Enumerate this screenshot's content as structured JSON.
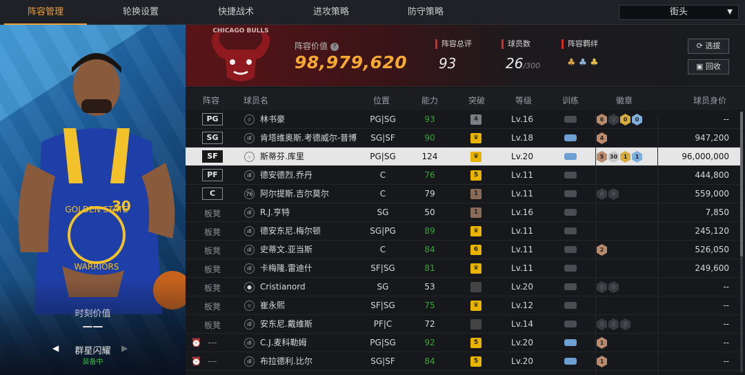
{
  "top_tabs": [
    "阵容管理",
    "轮换设置",
    "快捷战术",
    "进攻策略",
    "防守策略"
  ],
  "active_tab": "阵容管理",
  "mode_select": {
    "value": "街头"
  },
  "left_panel": {
    "moment_label": "时刻价值",
    "moment_value": "——",
    "skin_name": "群星闪耀",
    "skin_status": "装备中"
  },
  "header": {
    "lineup_value_label": "阵容价值",
    "lineup_value": "98,979,620",
    "overall_label": "阵容总评",
    "overall_value": "93",
    "roster_label": "球员数",
    "roster_count": "26",
    "roster_max": "/300",
    "chemistry_label": "阵容羁绊",
    "select_button": "选拔",
    "recycle_button": "回收",
    "logo_text": "CHICAGO BULLS"
  },
  "columns": [
    "阵容",
    "球员名",
    "位置",
    "能力",
    "突破",
    "等级",
    "训练",
    "徽章",
    "球员身价"
  ],
  "players": [
    {
      "slot": "PG",
      "name": "林书豪",
      "pos": "PG|SG",
      "ability": "93",
      "ability_green": true,
      "breakthrough": "4",
      "brk_style": "grey",
      "level": "Lv.16",
      "train": "grey",
      "badges": [
        [
          "b",
          "6"
        ],
        [
          "e",
          "0"
        ],
        [
          "g",
          "0"
        ],
        [
          "h",
          "0"
        ]
      ],
      "value": "--",
      "icon": "☆"
    },
    {
      "slot": "SG",
      "name": "肯塔维奥斯.考德威尔-普博",
      "pos": "SG|SF",
      "ability": "90",
      "ability_green": true,
      "breakthrough": "♛",
      "brk_style": "gold",
      "level": "Lv.18",
      "train": "blue",
      "badges": [
        [
          "b",
          "4"
        ]
      ],
      "value": "947,200",
      "icon": "ıll"
    },
    {
      "slot": "SF",
      "name": "斯蒂芬.库里",
      "pos": "PG|SG",
      "ability": "124",
      "ability_green": false,
      "breakthrough": "♛",
      "brk_style": "gold",
      "level": "Lv.20",
      "train": "blue",
      "badges": [
        [
          "b",
          "5"
        ],
        [
          "s",
          "30"
        ],
        [
          "g",
          "1"
        ],
        [
          "h",
          "1"
        ]
      ],
      "value": "96,000,000",
      "icon": "◆",
      "selected": true
    },
    {
      "slot": "PF",
      "name": "德安德烈.乔丹",
      "pos": "C",
      "ability": "76",
      "ability_green": true,
      "breakthrough": "5",
      "brk_style": "gold",
      "level": "Lv.11",
      "train": "grey",
      "badges": [],
      "value": "444,800",
      "icon": "ıll"
    },
    {
      "slot": "C",
      "name": "阿尔提斯.吉尔莫尔",
      "pos": "C",
      "ability": "79",
      "ability_green": false,
      "breakthrough": "1",
      "brk_style": "brown",
      "level": "Lv.11",
      "train": "grey",
      "badges": [
        [
          "e",
          "0"
        ],
        [
          "e",
          "0"
        ]
      ],
      "value": "559,000",
      "icon": "76"
    },
    {
      "slot": "板凳",
      "name": "R.J.亨特",
      "pos": "SG",
      "ability": "50",
      "ability_green": false,
      "breakthrough": "1",
      "brk_style": "brown",
      "level": "Lv.16",
      "train": "grey",
      "badges": [],
      "value": "7,850",
      "icon": "ıll"
    },
    {
      "slot": "板凳",
      "name": "德安东尼.梅尔顿",
      "pos": "SG|PG",
      "ability": "89",
      "ability_green": true,
      "breakthrough": "♛",
      "brk_style": "gold",
      "level": "Lv.11",
      "train": "grey",
      "badges": [],
      "value": "245,120",
      "icon": "ıll"
    },
    {
      "slot": "板凳",
      "name": "史蒂文.亚当斯",
      "pos": "C",
      "ability": "84",
      "ability_green": true,
      "breakthrough": "6",
      "brk_style": "gold",
      "level": "Lv.11",
      "train": "grey",
      "badges": [
        [
          "b",
          "2"
        ]
      ],
      "value": "526,050",
      "icon": "ıll"
    },
    {
      "slot": "板凳",
      "name": "卡梅隆.雷迪什",
      "pos": "SF|SG",
      "ability": "81",
      "ability_green": true,
      "breakthrough": "♛",
      "brk_style": "gold",
      "level": "Lv.11",
      "train": "grey",
      "badges": [],
      "value": "249,600",
      "icon": "ıll"
    },
    {
      "slot": "板凳",
      "name": "Cristianord",
      "pos": "SG",
      "ability": "53",
      "ability_green": false,
      "breakthrough": "",
      "brk_style": "dark",
      "level": "Lv.20",
      "train": "grey",
      "badges": [
        [
          "e",
          "0"
        ],
        [
          "e",
          "0"
        ]
      ],
      "value": "--",
      "icon": "●"
    },
    {
      "slot": "板凳",
      "name": "崔永熙",
      "pos": "SF|SG",
      "ability": "75",
      "ability_green": true,
      "breakthrough": "♛",
      "brk_style": "gold",
      "level": "Lv.12",
      "train": "grey",
      "badges": [],
      "value": "--",
      "icon": "☆"
    },
    {
      "slot": "板凳",
      "name": "安东尼.戴维斯",
      "pos": "PF|C",
      "ability": "72",
      "ability_green": false,
      "breakthrough": "",
      "brk_style": "dark",
      "level": "Lv.14",
      "train": "grey",
      "badges": [
        [
          "e",
          "0"
        ],
        [
          "e",
          "0"
        ],
        [
          "e",
          "0"
        ]
      ],
      "value": "--",
      "icon": "ıll"
    },
    {
      "slot": "---",
      "name": "C.J.麦科勒姆",
      "pos": "PG|SG",
      "ability": "92",
      "ability_green": true,
      "breakthrough": "5",
      "brk_style": "gold",
      "level": "Lv.20",
      "train": "blue",
      "badges": [
        [
          "b",
          "1"
        ]
      ],
      "value": "--",
      "icon": "ıll",
      "alarm": true
    },
    {
      "slot": "---",
      "name": "布拉德利.比尔",
      "pos": "SG|SF",
      "ability": "84",
      "ability_green": true,
      "breakthrough": "5",
      "brk_style": "gold",
      "level": "Lv.20",
      "train": "blue",
      "badges": [
        [
          "b",
          "1"
        ]
      ],
      "value": "--",
      "icon": "ıll",
      "alarm": true
    }
  ],
  "colors": {
    "accent": "#f0a03a",
    "value_gold": "#f5a833",
    "green": "#39a839",
    "red_marker": "#d12a2a"
  }
}
